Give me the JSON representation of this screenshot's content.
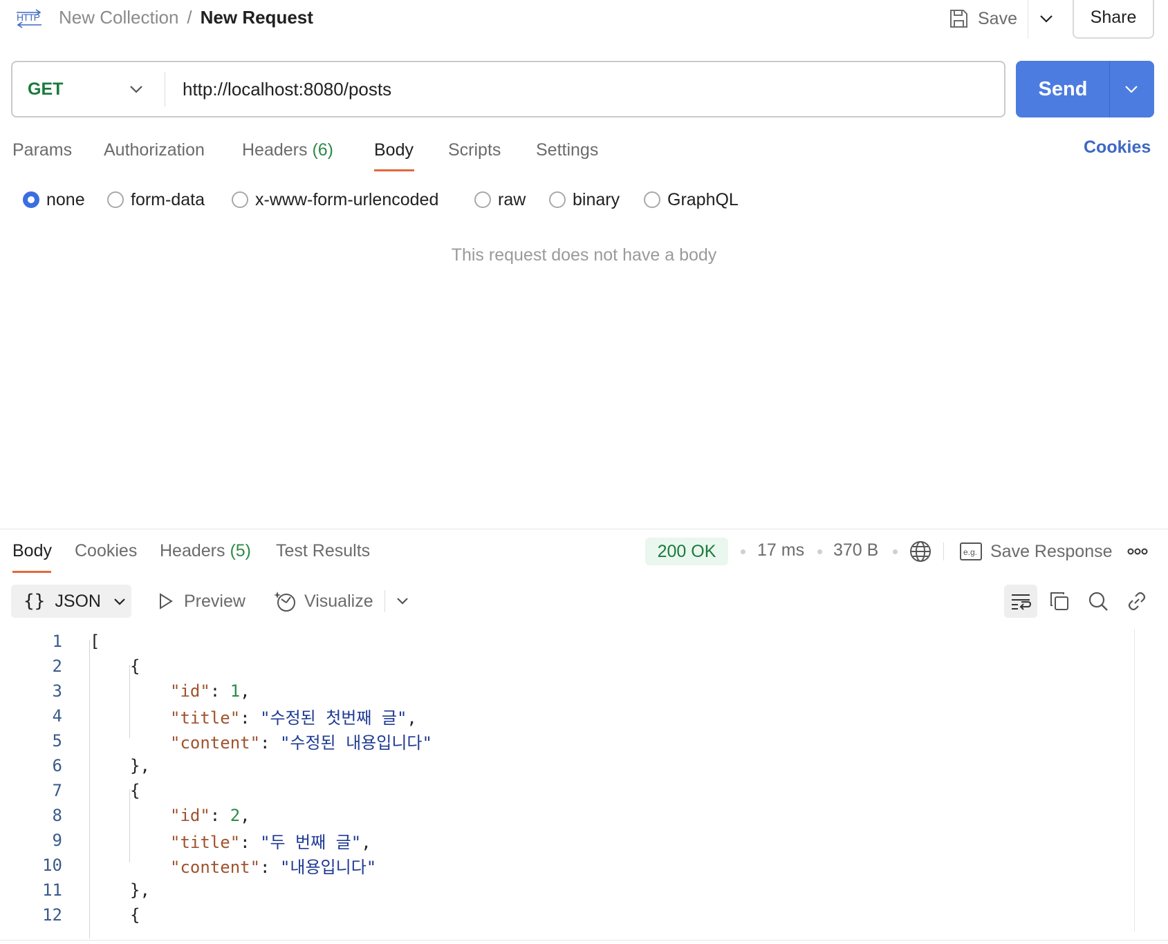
{
  "breadcrumb": {
    "collection": "New Collection",
    "separator": "/",
    "current": "New Request",
    "icon": "http-icon"
  },
  "toolbar": {
    "save_label": "Save",
    "share_label": "Share"
  },
  "request": {
    "method": "GET",
    "url": "http://localhost:8080/posts",
    "send_label": "Send"
  },
  "request_tabs": {
    "items": [
      {
        "label": "Params",
        "count": ""
      },
      {
        "label": "Authorization",
        "count": ""
      },
      {
        "label": "Headers",
        "count": "(6)"
      },
      {
        "label": "Body",
        "count": ""
      },
      {
        "label": "Scripts",
        "count": ""
      },
      {
        "label": "Settings",
        "count": ""
      }
    ],
    "active": "Body",
    "cookies_label": "Cookies"
  },
  "body_types": {
    "options": [
      "none",
      "form-data",
      "x-www-form-urlencoded",
      "raw",
      "binary",
      "GraphQL"
    ],
    "selected": "none",
    "empty_message": "This request does not have a body"
  },
  "response": {
    "tabs": [
      {
        "label": "Body",
        "count": ""
      },
      {
        "label": "Cookies",
        "count": ""
      },
      {
        "label": "Headers",
        "count": "(5)"
      },
      {
        "label": "Test Results",
        "count": ""
      }
    ],
    "active_tab": "Body",
    "status": "200 OK",
    "time": "17 ms",
    "size": "370 B",
    "save_response_label": "Save Response",
    "format": "JSON",
    "preview_label": "Preview",
    "visualize_label": "Visualize",
    "code_lines": [
      {
        "n": "1",
        "text": "["
      },
      {
        "n": "2",
        "text": "{"
      },
      {
        "n": "3",
        "key": "\"id\"",
        "val": "1",
        "type": "num",
        "trail": ","
      },
      {
        "n": "4",
        "key": "\"title\"",
        "val": "\"수정된 첫번째 글\"",
        "type": "str",
        "trail": ","
      },
      {
        "n": "5",
        "key": "\"content\"",
        "val": "\"수정된 내용입니다\"",
        "type": "str",
        "trail": ""
      },
      {
        "n": "6",
        "text": "},"
      },
      {
        "n": "7",
        "text": "{"
      },
      {
        "n": "8",
        "key": "\"id\"",
        "val": "2",
        "type": "num",
        "trail": ","
      },
      {
        "n": "9",
        "key": "\"title\"",
        "val": "\"두 번째 글\"",
        "type": "str",
        "trail": ","
      },
      {
        "n": "10",
        "key": "\"content\"",
        "val": "\"내용입니다\"",
        "type": "str",
        "trail": ""
      },
      {
        "n": "11",
        "text": "},"
      },
      {
        "n": "12",
        "text": "{"
      }
    ]
  },
  "colors": {
    "accent": "#4c7ce0",
    "method_get": "#1a7a3c",
    "tab_underline": "#e5673b",
    "status_bg": "#e9f7ee"
  }
}
